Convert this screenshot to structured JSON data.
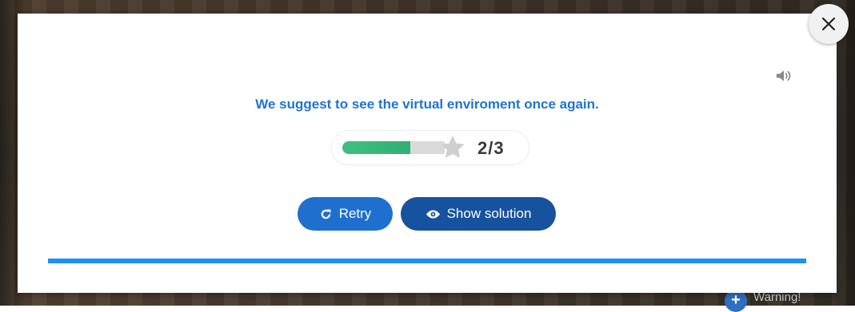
{
  "feedback": {
    "message": "We suggest to see the virtual enviroment once again."
  },
  "score": {
    "value": "2/3",
    "progress_fraction": 0.667,
    "fill_color": "#3fbf7f"
  },
  "buttons": {
    "retry_label": "Retry",
    "show_solution_label": "Show solution"
  },
  "background": {
    "warning_label": "Warning!"
  },
  "icons": {
    "close": "close-icon",
    "audio": "speaker-icon",
    "star": "star-icon",
    "retry": "refresh-icon",
    "solution": "eye-icon"
  },
  "colors": {
    "accent": "#1f74d1",
    "retry_button": "#1f6fcf",
    "solution_button": "#17529e",
    "divider": "#1e90ee"
  }
}
